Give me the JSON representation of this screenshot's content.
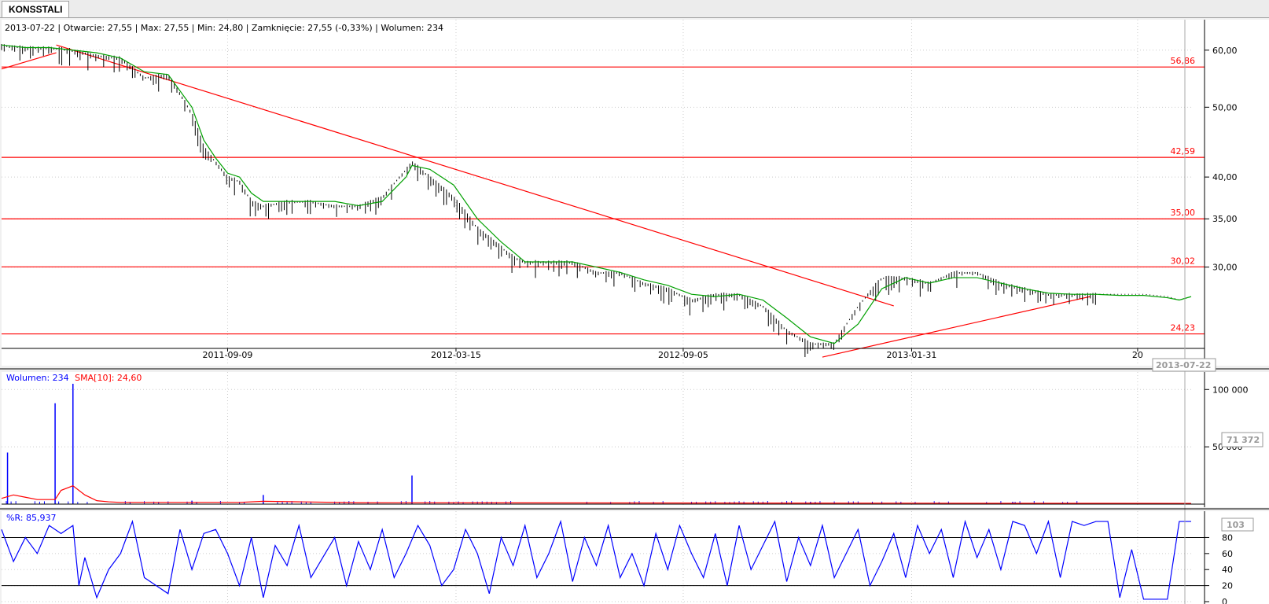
{
  "tab": {
    "label": "KONSSTALI"
  },
  "info_line": "2013-07-22 | Otwarcie: 27,55 | Max: 27,55 | Min: 24,80 | Zamknięcie: 27,55 (-0,33%) | Wolumen: 234",
  "volume_legend": {
    "volume": "Wolumen: 234",
    "sma": "SMA[10]: 24,60"
  },
  "wr_legend": "%R: 85,937",
  "cursor": {
    "date_label": "2013-07-22",
    "volume_label": "71 372",
    "wr_label": "103"
  },
  "colors": {
    "price": "#000000",
    "sma": "#00a000",
    "lines": "#ff0000",
    "volume": "#0000ff",
    "volume_sma": "#ff0000",
    "wr": "#0000ff"
  },
  "chart_data": [
    {
      "type": "line",
      "panel": "price",
      "scale": "log",
      "ylim": [
        22.0,
        64.5
      ],
      "x_ticks": [
        "2011-09-09",
        "2012-03-15",
        "2012-09-05",
        "2013-01-31",
        "20"
      ],
      "y_ticks": [
        "60,00",
        "50,00",
        "40,00",
        "35,00",
        "30,00"
      ],
      "y_tick_values": [
        60,
        50,
        40,
        35,
        30
      ],
      "support_levels": [
        {
          "value": 56.86,
          "label": "56,86"
        },
        {
          "value": 42.59,
          "label": "42,59"
        },
        {
          "value": 35.0,
          "label": "35,00"
        },
        {
          "value": 30.02,
          "label": "30,02"
        },
        {
          "value": 24.23,
          "label": "24,23"
        }
      ],
      "trendlines": [
        {
          "from": [
            0.0,
            56.5
          ],
          "to": [
            0.046,
            59.5
          ]
        },
        {
          "from": [
            0.046,
            61.0
          ],
          "to": [
            0.75,
            26.5
          ]
        },
        {
          "from": [
            0.69,
            22.5
          ],
          "to": [
            0.915,
            27.3
          ]
        }
      ],
      "series": [
        {
          "name": "close",
          "x": [
            0,
            0.02,
            0.04,
            0.06,
            0.08,
            0.1,
            0.12,
            0.14,
            0.16,
            0.17,
            0.18,
            0.19,
            0.2,
            0.21,
            0.22,
            0.24,
            0.26,
            0.28,
            0.3,
            0.32,
            0.34,
            0.345,
            0.36,
            0.38,
            0.4,
            0.42,
            0.43,
            0.44,
            0.46,
            0.48,
            0.5,
            0.52,
            0.54,
            0.56,
            0.58,
            0.6,
            0.62,
            0.64,
            0.66,
            0.68,
            0.7,
            0.72,
            0.74,
            0.76,
            0.78,
            0.8,
            0.82,
            0.84,
            0.86,
            0.88,
            0.9,
            0.92,
            0.94,
            0.96,
            0.98,
            0.99,
            1.0
          ],
          "values": [
            61,
            60.5,
            60.5,
            60,
            59,
            58.5,
            55,
            55.5,
            49,
            44,
            42,
            40,
            39.5,
            37,
            36.5,
            37,
            37,
            36.5,
            36.5,
            37.5,
            41,
            42,
            40,
            37.5,
            34,
            32,
            31,
            30.5,
            30.5,
            30.5,
            29.5,
            29.5,
            28.5,
            28,
            27,
            27.5,
            27.5,
            26.5,
            24.5,
            23.5,
            23.5,
            26.5,
            29,
            29,
            28.5,
            29.5,
            29.5,
            28.5,
            28,
            27.5,
            27.5,
            27.5,
            27.5,
            27.5,
            27.3,
            27,
            27.3
          ]
        },
        {
          "name": "SMA",
          "x": [
            0,
            0.02,
            0.04,
            0.06,
            0.08,
            0.1,
            0.12,
            0.14,
            0.16,
            0.17,
            0.18,
            0.19,
            0.2,
            0.21,
            0.22,
            0.24,
            0.26,
            0.28,
            0.3,
            0.32,
            0.34,
            0.345,
            0.36,
            0.38,
            0.4,
            0.42,
            0.43,
            0.44,
            0.46,
            0.48,
            0.5,
            0.52,
            0.54,
            0.56,
            0.58,
            0.6,
            0.62,
            0.64,
            0.66,
            0.68,
            0.7,
            0.72,
            0.74,
            0.76,
            0.78,
            0.8,
            0.82,
            0.84,
            0.86,
            0.88,
            0.9,
            0.92,
            0.94,
            0.96,
            0.98,
            0.99,
            1.0
          ],
          "values": [
            61,
            60.5,
            60.5,
            60,
            59.5,
            58.5,
            56,
            55.5,
            50,
            45,
            42.5,
            40.5,
            40,
            38,
            37,
            37,
            37,
            37,
            36.5,
            37,
            40,
            41.5,
            41,
            39,
            35,
            32.5,
            31.5,
            30.5,
            30.5,
            30.5,
            30,
            29.5,
            28.8,
            28.3,
            27.5,
            27.3,
            27.5,
            27,
            25.5,
            24,
            23.5,
            25,
            28,
            29,
            28.5,
            29,
            29,
            28.5,
            28,
            27.6,
            27.5,
            27.5,
            27.4,
            27.4,
            27.2,
            27,
            27.3
          ]
        }
      ]
    },
    {
      "type": "line",
      "panel": "volume",
      "ylim": [
        0,
        105000
      ],
      "y_ticks": [
        "100 000",
        "50 000"
      ],
      "y_tick_values": [
        100000,
        50000
      ],
      "series": [
        {
          "name": "Wolumen",
          "spikes": [
            [
              0.005,
              45000
            ],
            [
              0.045,
              88000
            ],
            [
              0.06,
              105000
            ],
            [
              0.22,
              8000
            ],
            [
              0.345,
              25000
            ],
            [
              0.16,
              3000
            ],
            [
              0.68,
              2000
            ],
            [
              0.85,
              2000
            ]
          ]
        },
        {
          "name": "SMA[10]",
          "x": [
            0,
            0.01,
            0.02,
            0.03,
            0.045,
            0.05,
            0.06,
            0.07,
            0.08,
            0.09,
            0.1,
            0.2,
            0.22,
            0.3,
            1.0
          ],
          "values": [
            5000,
            8000,
            6000,
            4000,
            4000,
            12000,
            16000,
            8000,
            3000,
            2000,
            1500,
            1500,
            2500,
            1200,
            600
          ]
        }
      ]
    },
    {
      "type": "line",
      "panel": "williams_r",
      "ylim": [
        0,
        103
      ],
      "y_ticks": [
        "80",
        "60",
        "40",
        "20",
        "0"
      ],
      "y_tick_values": [
        80,
        60,
        40,
        20,
        0
      ],
      "levels": [
        80,
        20
      ],
      "series": [
        {
          "name": "%R",
          "x": [
            0,
            0.01,
            0.02,
            0.03,
            0.04,
            0.05,
            0.06,
            0.065,
            0.07,
            0.08,
            0.09,
            0.1,
            0.11,
            0.12,
            0.13,
            0.14,
            0.15,
            0.16,
            0.17,
            0.18,
            0.19,
            0.2,
            0.21,
            0.22,
            0.23,
            0.24,
            0.25,
            0.26,
            0.27,
            0.28,
            0.29,
            0.3,
            0.31,
            0.32,
            0.33,
            0.34,
            0.35,
            0.36,
            0.37,
            0.38,
            0.39,
            0.4,
            0.41,
            0.42,
            0.43,
            0.44,
            0.45,
            0.46,
            0.47,
            0.48,
            0.49,
            0.5,
            0.51,
            0.52,
            0.53,
            0.54,
            0.55,
            0.56,
            0.57,
            0.58,
            0.59,
            0.6,
            0.61,
            0.62,
            0.63,
            0.64,
            0.65,
            0.66,
            0.67,
            0.68,
            0.69,
            0.7,
            0.71,
            0.72,
            0.73,
            0.74,
            0.75,
            0.76,
            0.77,
            0.78,
            0.79,
            0.8,
            0.81,
            0.82,
            0.83,
            0.84,
            0.85,
            0.86,
            0.87,
            0.88,
            0.89,
            0.9,
            0.91,
            0.92,
            0.93,
            0.94,
            0.95,
            0.96,
            0.97,
            0.98,
            0.99,
            1.0
          ],
          "values": [
            90,
            50,
            80,
            60,
            95,
            85,
            95,
            20,
            55,
            5,
            40,
            60,
            100,
            30,
            20,
            10,
            90,
            40,
            85,
            90,
            60,
            20,
            80,
            5,
            70,
            45,
            95,
            30,
            55,
            80,
            20,
            75,
            40,
            90,
            30,
            60,
            95,
            70,
            20,
            40,
            90,
            60,
            10,
            80,
            45,
            95,
            30,
            60,
            100,
            25,
            80,
            45,
            95,
            30,
            60,
            20,
            85,
            40,
            95,
            60,
            30,
            85,
            20,
            95,
            40,
            70,
            100,
            25,
            80,
            45,
            95,
            30,
            60,
            90,
            20,
            50,
            85,
            30,
            95,
            60,
            90,
            30,
            100,
            55,
            90,
            40,
            100,
            95,
            60,
            100,
            30,
            100,
            95,
            100,
            100,
            5,
            65,
            3,
            3,
            3,
            100,
            100
          ]
        }
      ]
    }
  ]
}
